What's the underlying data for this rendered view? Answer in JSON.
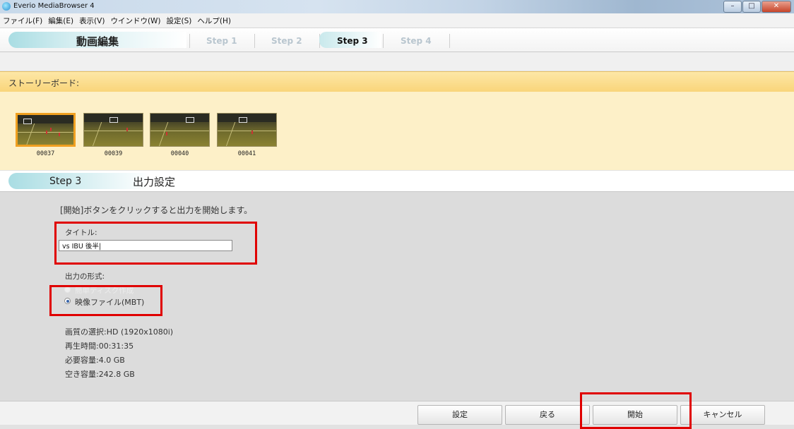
{
  "window": {
    "title": "Everio MediaBrowser 4",
    "minimize": "–",
    "maximize": "□",
    "close": "✕"
  },
  "menu": [
    "ファイル(F)",
    "編集(E)",
    "表示(V)",
    "ウインドウ(W)",
    "設定(S)",
    "ヘルプ(H)"
  ],
  "header": {
    "mode": "動画編集",
    "steps": [
      "Step 1",
      "Step 2",
      "Step 3",
      "Step 4"
    ],
    "active_step": "Step 3"
  },
  "storyboard": {
    "label": "ストーリーボード:",
    "clips": [
      {
        "label": "00037",
        "selected": true
      },
      {
        "label": "00039",
        "selected": false
      },
      {
        "label": "00040",
        "selected": false
      },
      {
        "label": "00041",
        "selected": false
      }
    ]
  },
  "section": {
    "step": "Step 3",
    "title": "出力設定"
  },
  "form": {
    "instruction": "[開始]ボタンをクリックすると出力を開始します。",
    "title_label": "タイトル:",
    "title_value": "vs IBU 後半|",
    "format_label": "出力の形式:",
    "option_disabled": "簡単ディスク作成",
    "option_selected": "映像ファイル(MBT)",
    "info": {
      "quality": "画質の選択:HD (1920x1080i)",
      "duration": "再生時間:00:31:35",
      "required": "必要容量:4.0 GB",
      "free": "空き容量:242.8 GB"
    }
  },
  "buttons": {
    "settings": "設定",
    "back": "戻る",
    "start": "開始",
    "cancel": "キャンセル"
  },
  "highlight_color": "#e00000"
}
